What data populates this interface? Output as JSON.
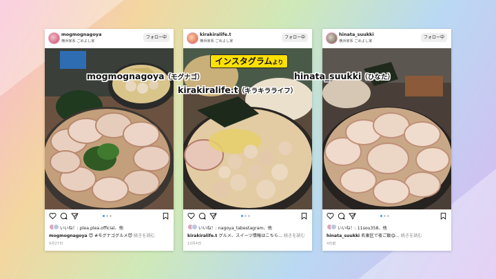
{
  "overlay": {
    "title_main": "インスタグラム",
    "title_suffix": "より",
    "names": [
      {
        "handle": "mogmognagoya",
        "reading": "（モグナゴ）"
      },
      {
        "handle": "kirakiralife.t",
        "reading": "（キラキラライフ）"
      },
      {
        "handle": "hinata_suukki",
        "reading": "（ひなた）"
      }
    ]
  },
  "posts": [
    {
      "username": "mogmognagoya",
      "location": "横浜家系 ごめよし家",
      "follow": "フォロー中",
      "likes": "いいね！: plea.plea.official、他",
      "caption_user": "mogmognagoya",
      "caption_text": "😈 #モグナゴグルメ😈",
      "more": "続きを読む",
      "date": "9月27日"
    },
    {
      "username": "kirakiralife.t",
      "location": "横浜家系 ごめよし家",
      "follow": "フォロー中",
      "likes": "いいね！: nagoya_tabestagram、他",
      "caption_user": "kirakiralife.t",
      "caption_text": "グルメ、スイーツ情報はこちら...",
      "more": "続きを読む",
      "date": "10月4日"
    },
    {
      "username": "hinata_suukki",
      "location": "横浜家系 ごめよし家",
      "follow": "フォロー中",
      "likes": "いいね！: 11sou358、他",
      "caption_user": "hinata_suukki",
      "caption_text": "名東区で夜ご飯😋...",
      "more": "続きを読む",
      "date": "4日前"
    }
  ],
  "icons": [
    "heart-icon",
    "comment-icon",
    "share-icon",
    "bookmark-icon"
  ],
  "colors": {
    "accent_blue": "#3897f0",
    "highlight_yellow": "#ffe100"
  }
}
